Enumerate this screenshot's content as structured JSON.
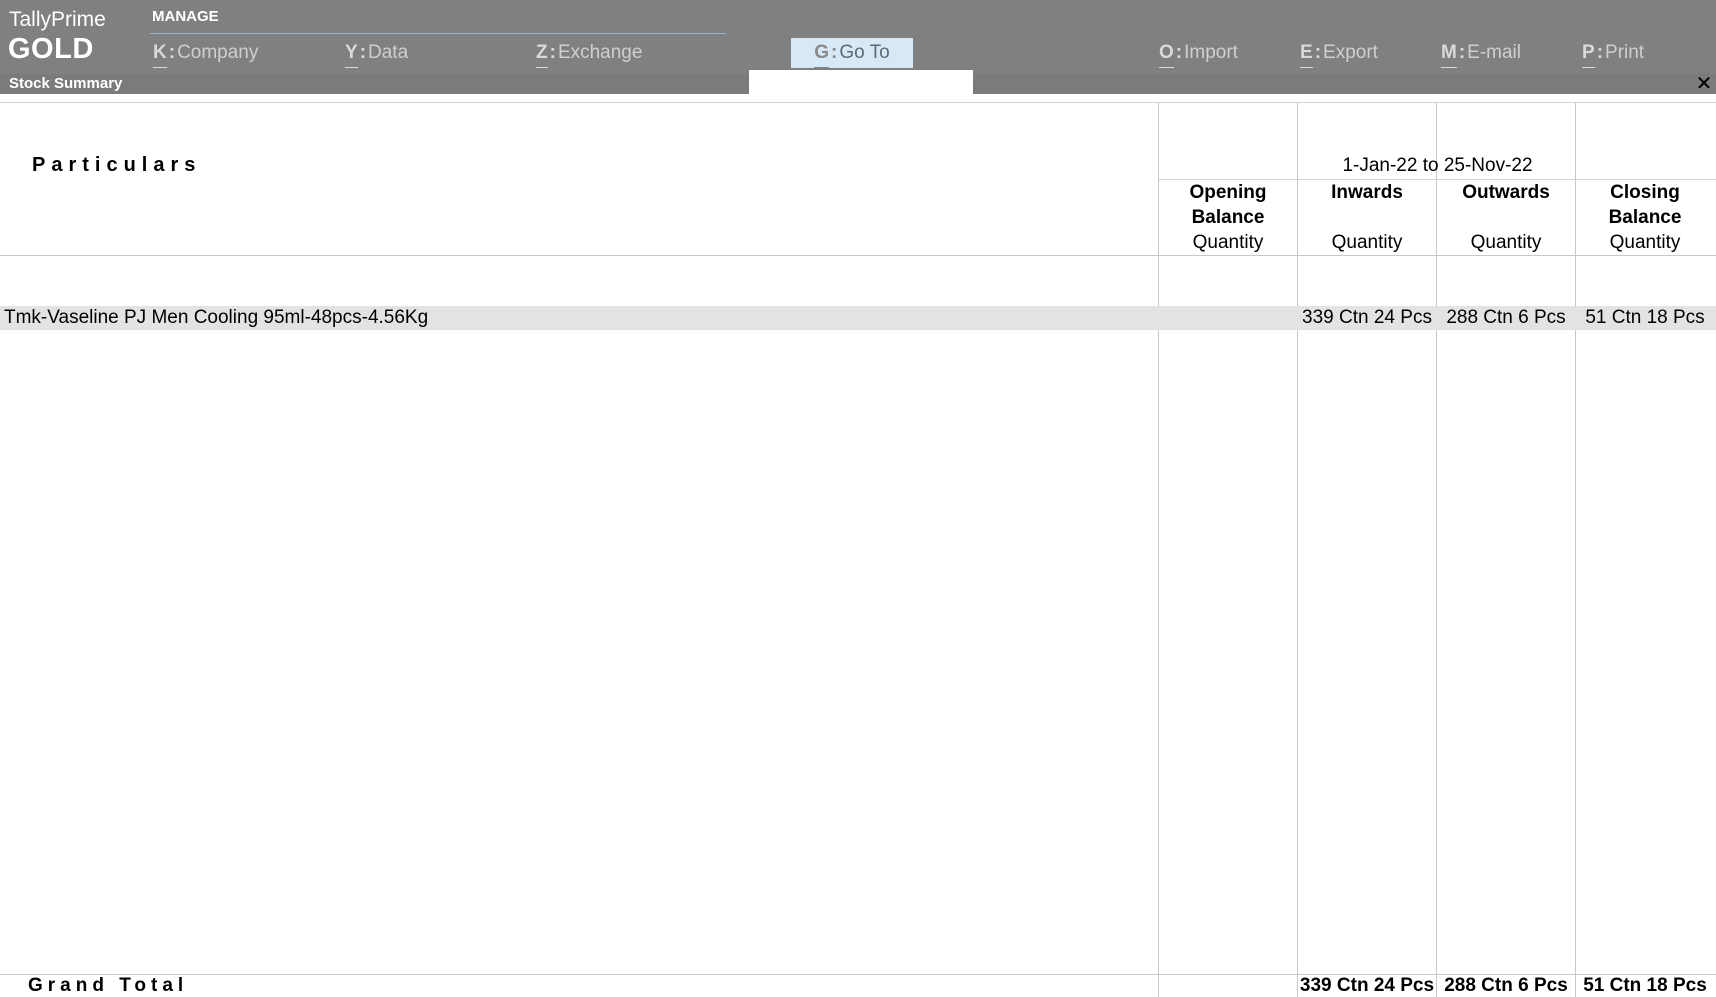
{
  "app": {
    "name": "TallyPrime",
    "edition": "GOLD"
  },
  "menu": {
    "section_title": "MANAGE",
    "items": [
      {
        "key": "K",
        "label": "Company"
      },
      {
        "key": "Y",
        "label": "Data"
      },
      {
        "key": "Z",
        "label": "Exchange"
      },
      {
        "key": "G",
        "label": "Go To"
      },
      {
        "key": "O",
        "label": "Import"
      },
      {
        "key": "E",
        "label": "Export"
      },
      {
        "key": "M",
        "label": "E-mail"
      },
      {
        "key": "P",
        "label": "Print"
      }
    ]
  },
  "report": {
    "title": "Stock Summary",
    "particulars_header": "Particulars",
    "period": "1-Jan-22 to 25-Nov-22",
    "columns": [
      {
        "line1": "Opening",
        "line2": "Balance",
        "unit": "Quantity"
      },
      {
        "line1": "Inwards",
        "line2": "",
        "unit": "Quantity"
      },
      {
        "line1": "Outwards",
        "line2": "",
        "unit": "Quantity"
      },
      {
        "line1": "Closing",
        "line2": "Balance",
        "unit": "Quantity"
      }
    ],
    "rows": [
      {
        "name": "Tmk-Vaseline PJ Men Cooling 95ml-48pcs-4.56Kg",
        "opening": "",
        "inwards": "339 Ctn 24 Pcs",
        "outwards": "288 Ctn 6 Pcs",
        "closing": "51 Ctn 18 Pcs"
      }
    ],
    "grand_total": {
      "label": "Grand Total",
      "opening": "",
      "inwards": "339 Ctn 24 Pcs",
      "outwards": "288 Ctn 6 Pcs",
      "closing": "51 Ctn 18 Pcs"
    }
  },
  "colors": {
    "topbar": "#808080",
    "goto_highlight": "#d7e8f6",
    "row_highlight": "#e3e3e3"
  }
}
